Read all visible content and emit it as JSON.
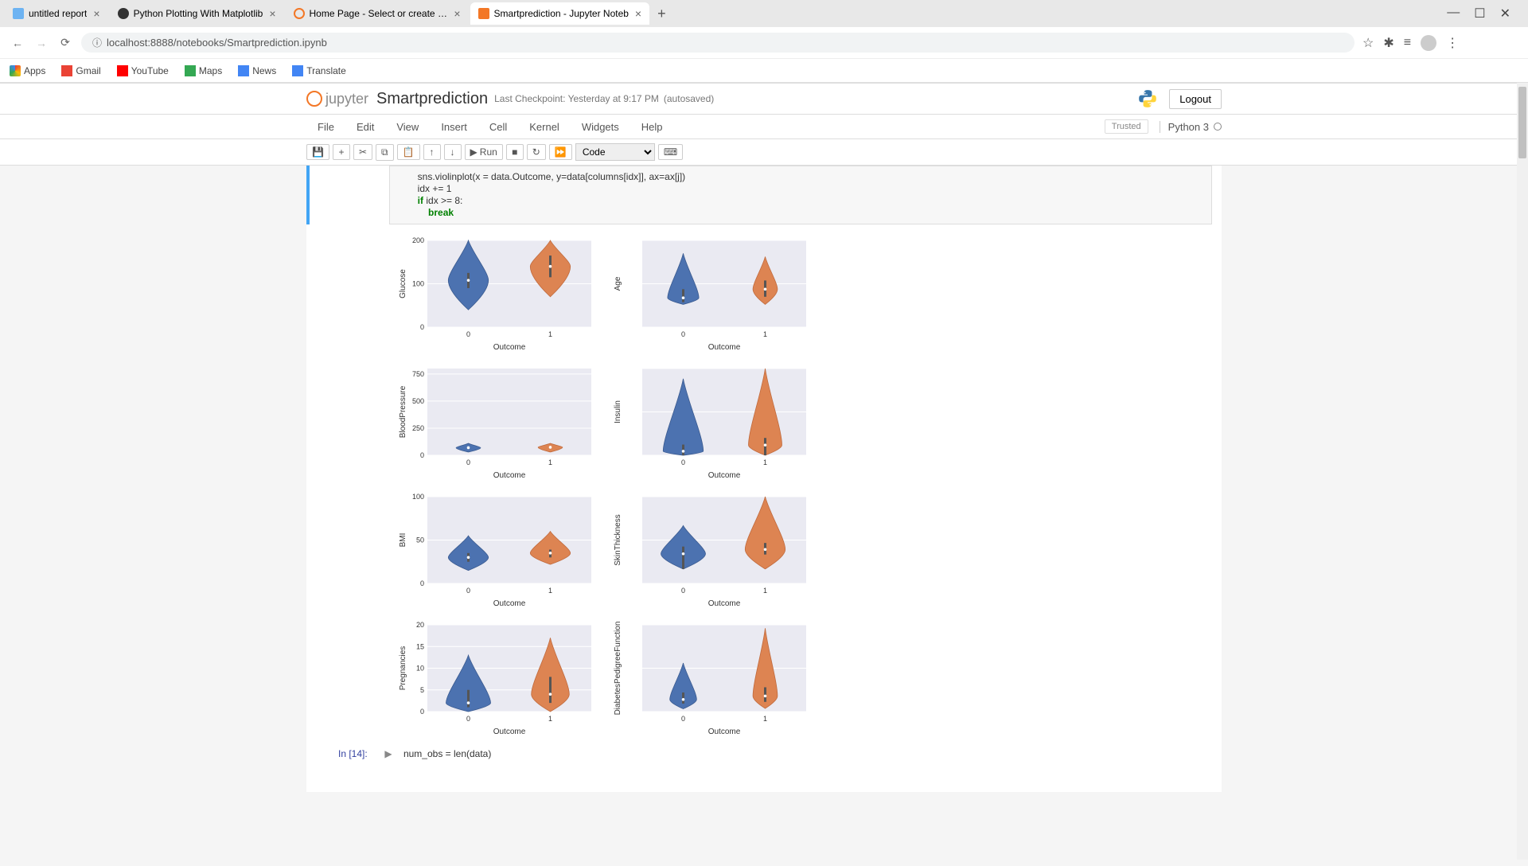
{
  "browser": {
    "tabs": [
      {
        "title": "untitled report"
      },
      {
        "title": "Python Plotting With Matplotlib"
      },
      {
        "title": "Home Page - Select or create a n"
      },
      {
        "title": "Smartprediction - Jupyter Noteb"
      }
    ],
    "url": "localhost:8888/notebooks/Smartprediction.ipynb",
    "bookmarks": [
      "Apps",
      "Gmail",
      "YouTube",
      "Maps",
      "News",
      "Translate"
    ]
  },
  "jupyter": {
    "logo_text": "jupyter",
    "notebook_name": "Smartprediction",
    "checkpoint": "Last Checkpoint: Yesterday at 9:17 PM",
    "autosaved": "(autosaved)",
    "logout": "Logout",
    "menu": [
      "File",
      "Edit",
      "View",
      "Insert",
      "Cell",
      "Kernel",
      "Widgets",
      "Help"
    ],
    "trusted": "Trusted",
    "kernel": "Python 3",
    "toolbar": {
      "run": "Run",
      "celltype": "Code"
    },
    "code_snippet": {
      "l1": "        sns.violinplot(x = data.Outcome, y=data[columns[idx]], ax=ax[j])",
      "l2": "        idx += 1",
      "l3_if": "        if",
      "l3_rest": " idx >= 8:",
      "l4_break_indent": "            ",
      "l4_break": "break"
    },
    "next_prompt": "In [14]:",
    "next_code": "num_obs = len(data)"
  },
  "chart_data": [
    {
      "type": "violin",
      "ylabel": "Glucose",
      "xlabel": "Outcome",
      "categories": [
        "0",
        "1"
      ],
      "yticks": [
        0,
        100,
        200
      ],
      "ylim": [
        0,
        200
      ],
      "series": [
        {
          "name": "0",
          "median": 108,
          "q1": 90,
          "q3": 125,
          "min": 40,
          "max": 200,
          "width": 0.9
        },
        {
          "name": "1",
          "median": 140,
          "q1": 115,
          "q3": 165,
          "min": 70,
          "max": 200,
          "width": 0.9
        }
      ]
    },
    {
      "type": "violin",
      "ylabel": "Age",
      "xlabel": "Outcome",
      "categories": [
        "0",
        "1"
      ],
      "yticks": [],
      "ylim": [
        0,
        80
      ],
      "series": [
        {
          "name": "0",
          "median": 27,
          "q1": 23,
          "q3": 35,
          "min": 21,
          "max": 68,
          "width": 0.7
        },
        {
          "name": "1",
          "median": 35,
          "q1": 28,
          "q3": 43,
          "min": 21,
          "max": 65,
          "width": 0.55
        }
      ]
    },
    {
      "type": "violin",
      "ylabel": "BloodPressure",
      "xlabel": "Outcome",
      "categories": [
        "0",
        "1"
      ],
      "yticks": [
        0,
        250,
        500,
        750
      ],
      "ylim": [
        0,
        800
      ],
      "series": [
        {
          "name": "0",
          "median": 70,
          "q1": 62,
          "q3": 78,
          "min": 30,
          "max": 110,
          "width": 0.55
        },
        {
          "name": "1",
          "median": 74,
          "q1": 66,
          "q3": 82,
          "min": 30,
          "max": 110,
          "width": 0.55
        }
      ]
    },
    {
      "type": "violin",
      "ylabel": "Insulin",
      "xlabel": "Outcome",
      "categories": [
        "0",
        "1"
      ],
      "yticks": [],
      "ylim": [
        0,
        850
      ],
      "series": [
        {
          "name": "0",
          "median": 40,
          "q1": 0,
          "q3": 105,
          "min": 0,
          "max": 750,
          "width": 0.9
        },
        {
          "name": "1",
          "median": 100,
          "q1": 0,
          "q3": 170,
          "min": 0,
          "max": 850,
          "width": 0.75
        }
      ]
    },
    {
      "type": "violin",
      "ylabel": "BMI",
      "xlabel": "Outcome",
      "categories": [
        "0",
        "1"
      ],
      "yticks": [
        0,
        50,
        100
      ],
      "ylim": [
        0,
        100
      ],
      "series": [
        {
          "name": "0",
          "median": 30,
          "q1": 25,
          "q3": 35,
          "min": 15,
          "max": 55,
          "width": 0.9
        },
        {
          "name": "1",
          "median": 35,
          "q1": 30,
          "q3": 39,
          "min": 22,
          "max": 60,
          "width": 0.9
        }
      ]
    },
    {
      "type": "violin",
      "ylabel": "SkinThickness",
      "xlabel": "Outcome",
      "categories": [
        "0",
        "1"
      ],
      "yticks": [],
      "ylim": [
        -20,
        100
      ],
      "series": [
        {
          "name": "0",
          "median": 21,
          "q1": 0,
          "q3": 31,
          "min": 0,
          "max": 60,
          "width": 1.0
        },
        {
          "name": "1",
          "median": 27,
          "q1": 20,
          "q3": 36,
          "min": 0,
          "max": 100,
          "width": 0.9
        }
      ]
    },
    {
      "type": "violin",
      "ylabel": "Pregnancies",
      "xlabel": "Outcome",
      "categories": [
        "0",
        "1"
      ],
      "yticks": [
        0,
        5,
        10,
        15,
        20
      ],
      "ylim": [
        0,
        20
      ],
      "series": [
        {
          "name": "0",
          "median": 2,
          "q1": 1,
          "q3": 5,
          "min": 0,
          "max": 13,
          "width": 1.0
        },
        {
          "name": "1",
          "median": 4,
          "q1": 2,
          "q3": 8,
          "min": 0,
          "max": 17,
          "width": 0.85
        }
      ]
    },
    {
      "type": "violin",
      "ylabel": "DiabetesPedigreeFunction",
      "xlabel": "Outcome",
      "categories": [
        "0",
        "1"
      ],
      "yticks": [],
      "ylim": [
        0,
        2.5
      ],
      "series": [
        {
          "name": "0",
          "median": 0.35,
          "q1": 0.23,
          "q3": 0.55,
          "min": 0.08,
          "max": 1.4,
          "width": 0.6
        },
        {
          "name": "1",
          "median": 0.45,
          "q1": 0.28,
          "q3": 0.7,
          "min": 0.09,
          "max": 2.4,
          "width": 0.55
        }
      ]
    }
  ]
}
